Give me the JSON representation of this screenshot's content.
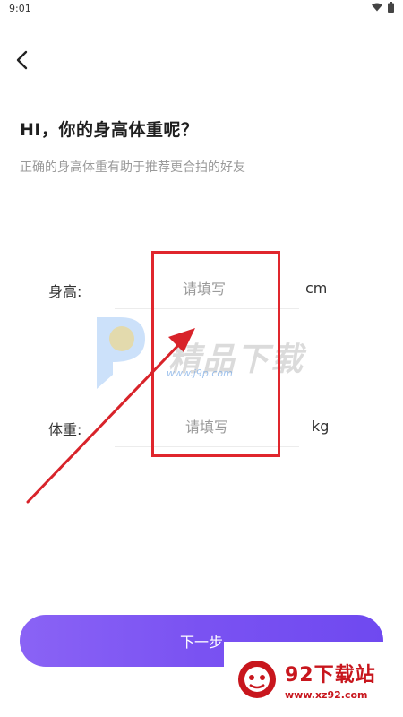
{
  "status_bar": {
    "time": "9:01"
  },
  "page": {
    "title": "HI，你的身高体重呢？",
    "subtitle": "正确的身高体重有助于推荐更合拍的好友"
  },
  "form": {
    "height": {
      "label": "身高:",
      "placeholder": "请填写",
      "unit": "cm"
    },
    "weight": {
      "label": "体重:",
      "placeholder": "请填写",
      "unit": "kg"
    }
  },
  "next_button": {
    "label": "下一步"
  },
  "watermark": {
    "text": "精品下载",
    "url": "www.j9p.com"
  },
  "corner_watermark": {
    "title": "92下载站",
    "url": "www.xz92.com"
  },
  "colors": {
    "accent": "#7a52f2",
    "annotation": "#e0262d"
  }
}
